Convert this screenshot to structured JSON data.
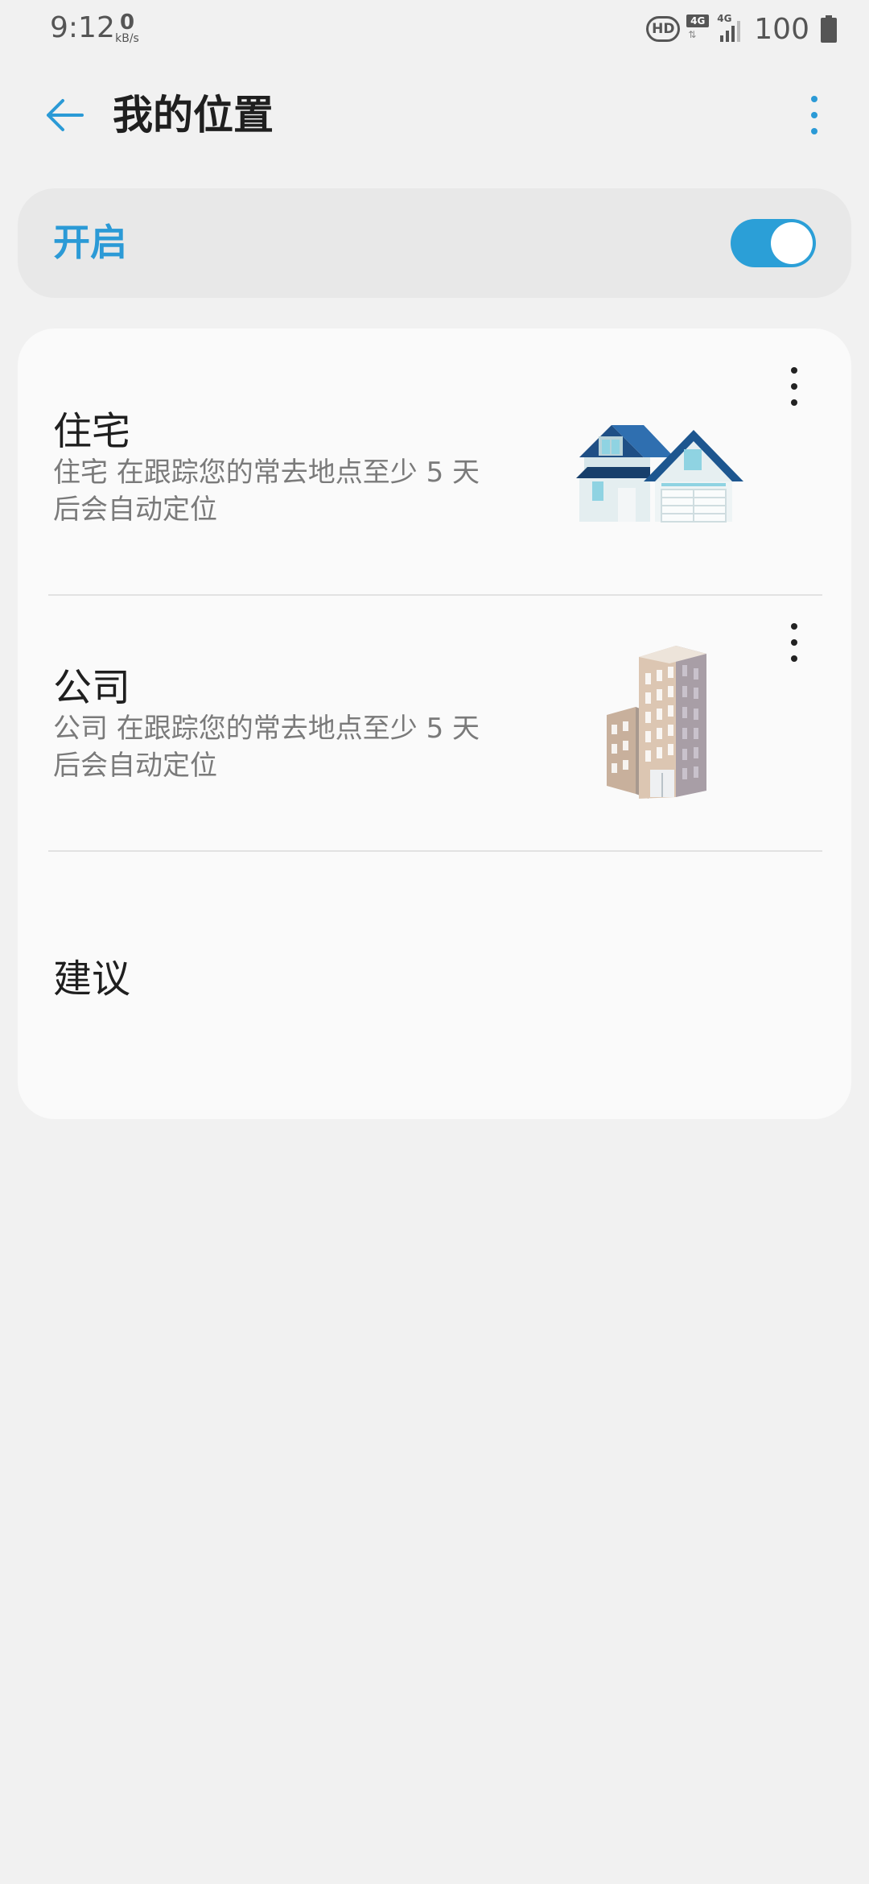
{
  "status_bar": {
    "time": "9:12",
    "net_speed_value": "0",
    "net_speed_unit": "kB/s",
    "hd_label": "HD",
    "network_type_1": "4G",
    "network_type_2": "4G",
    "battery_percent": "100"
  },
  "header": {
    "title": "我的位置",
    "back_icon": "back-arrow-icon",
    "more_icon": "more-vertical-icon"
  },
  "location_toggle": {
    "label": "开启",
    "enabled": true
  },
  "places": [
    {
      "title": "住宅",
      "description": "住宅 在跟踪您的常去地点至少 5 天后会自动定位",
      "icon": "house-icon"
    },
    {
      "title": "公司",
      "description": "公司 在跟踪您的常去地点至少 5 天后会自动定位",
      "icon": "office-building-icon"
    }
  ],
  "suggestions": {
    "title": "建议"
  },
  "colors": {
    "accent": "#2b9ad6",
    "background": "#f1f1f1",
    "card": "#fafafa",
    "toggle_card": "#e8e8e8",
    "secondary_text": "#7a7a7a"
  }
}
